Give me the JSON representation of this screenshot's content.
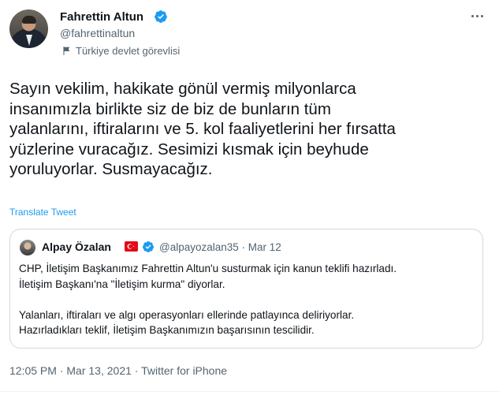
{
  "author": {
    "name": "Fahrettin Altun",
    "handle": "@fahrettinaltun",
    "label": "Türkiye devlet görevlisi"
  },
  "tweet": {
    "text": "Sayın vekilim, hakikate gönül vermiş milyonlarca\ninsanımızla birlikte siz de biz de bunların tüm\nyalanlarını, iftiralarını ve 5. kol faaliyetlerini her fırsatta\nyüzlerine vuracağız. Sesimizi kısmak için beyhude\nyoruluyorlar. Susmayacağız.",
    "translate_label": "Translate Tweet",
    "time": "12:05 PM",
    "date": "Mar 13, 2021",
    "source": "Twitter for iPhone",
    "separator": " · "
  },
  "quote": {
    "name": "Alpay Özalan",
    "handle_date": "@alpayozalan35 · Mar 12",
    "text": "CHP, İletişim Başkanımız Fahrettin Altun'u susturmak için kanun teklifi hazırladı.\nİletişim Başkanı'na \"İletişim kurma\" diyorlar.\n\nYalanları, iftiraları ve algı operasyonları ellerinde patlayınca deliriyorlar.\nHazırladıkları teklif, İletişim Başkanımızın başarısının tescilidir."
  },
  "icons": {
    "verified": "verified-badge-icon",
    "government": "flag-icon",
    "more": "more-icon",
    "country_flag": "turkey-flag-icon"
  },
  "colors": {
    "text": "#0f1419",
    "secondary": "#536471",
    "link": "#1d9bf0",
    "verified": "#1d9bf0",
    "border": "#cfd9de",
    "turkey_red": "#e30a17"
  }
}
